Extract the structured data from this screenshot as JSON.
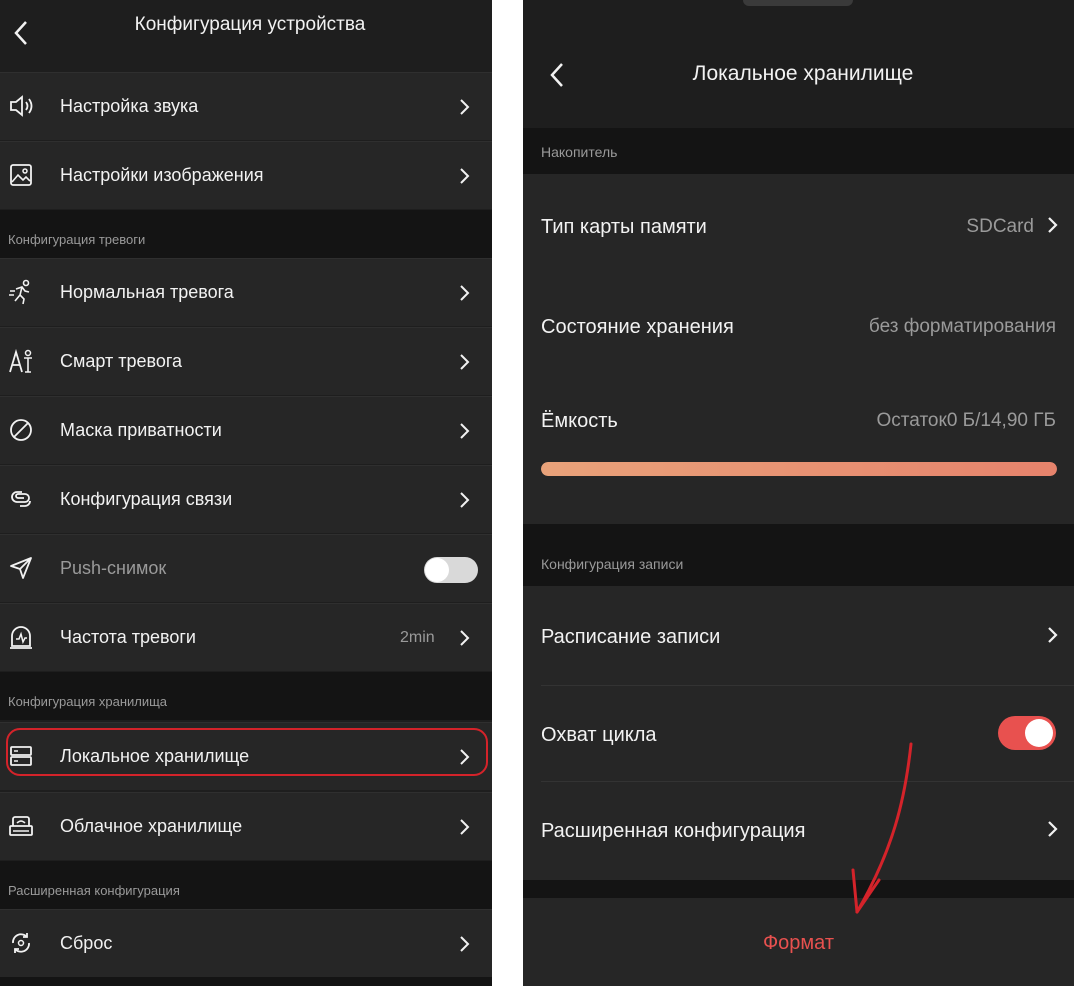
{
  "left": {
    "header": {
      "title": "Конфигурация устройства"
    },
    "rows_top": [
      {
        "label": "Настройка звука",
        "icon": "speaker-icon"
      },
      {
        "label": "Настройки изображения",
        "icon": "image-icon"
      }
    ],
    "section_alarm": "Конфигурация тревоги",
    "rows_alarm": [
      {
        "label": "Нормальная тревога",
        "icon": "running-person-icon"
      },
      {
        "label": "Смарт тревога",
        "icon": "smart-person-icon"
      },
      {
        "label": "Маска приватности",
        "icon": "privacy-mask-icon"
      },
      {
        "label": "Конфигурация связи",
        "icon": "link-icon"
      },
      {
        "label": "Push-снимок",
        "icon": "send-icon",
        "toggle": false
      },
      {
        "label": "Частота тревоги",
        "icon": "alarm-frequency-icon",
        "value": "2min"
      }
    ],
    "section_storage": "Конфигурация хранилища",
    "rows_storage": [
      {
        "label": "Локальное хранилище",
        "icon": "local-storage-icon"
      },
      {
        "label": "Облачное хранилище",
        "icon": "cloud-storage-icon"
      }
    ],
    "section_advanced": "Расширенная конфигурация",
    "rows_advanced": [
      {
        "label": "Сброс",
        "icon": "reset-icon"
      }
    ]
  },
  "right": {
    "header": {
      "title": "Локальное хранилище"
    },
    "section_drive": "Накопитель",
    "card_type": {
      "label": "Тип карты памяти",
      "value": "SDCard"
    },
    "storage_state": {
      "label": "Состояние хранения",
      "value": "без форматирования"
    },
    "capacity": {
      "label": "Ёмкость",
      "value": "Остаток0 Б/14,90 ГБ",
      "progress": 1.0
    },
    "section_record": "Конфигурация записи",
    "schedule": {
      "label": "Расписание записи"
    },
    "loop": {
      "label": "Охват цикла",
      "toggle": true
    },
    "advanced": {
      "label": "Расширенная конфигурация"
    },
    "format_button": "Формат"
  },
  "colors": {
    "accent": "#e8514f",
    "annotation": "#d4232a",
    "background": "#1e1e1e",
    "row": "#262626",
    "section": "#141414"
  }
}
